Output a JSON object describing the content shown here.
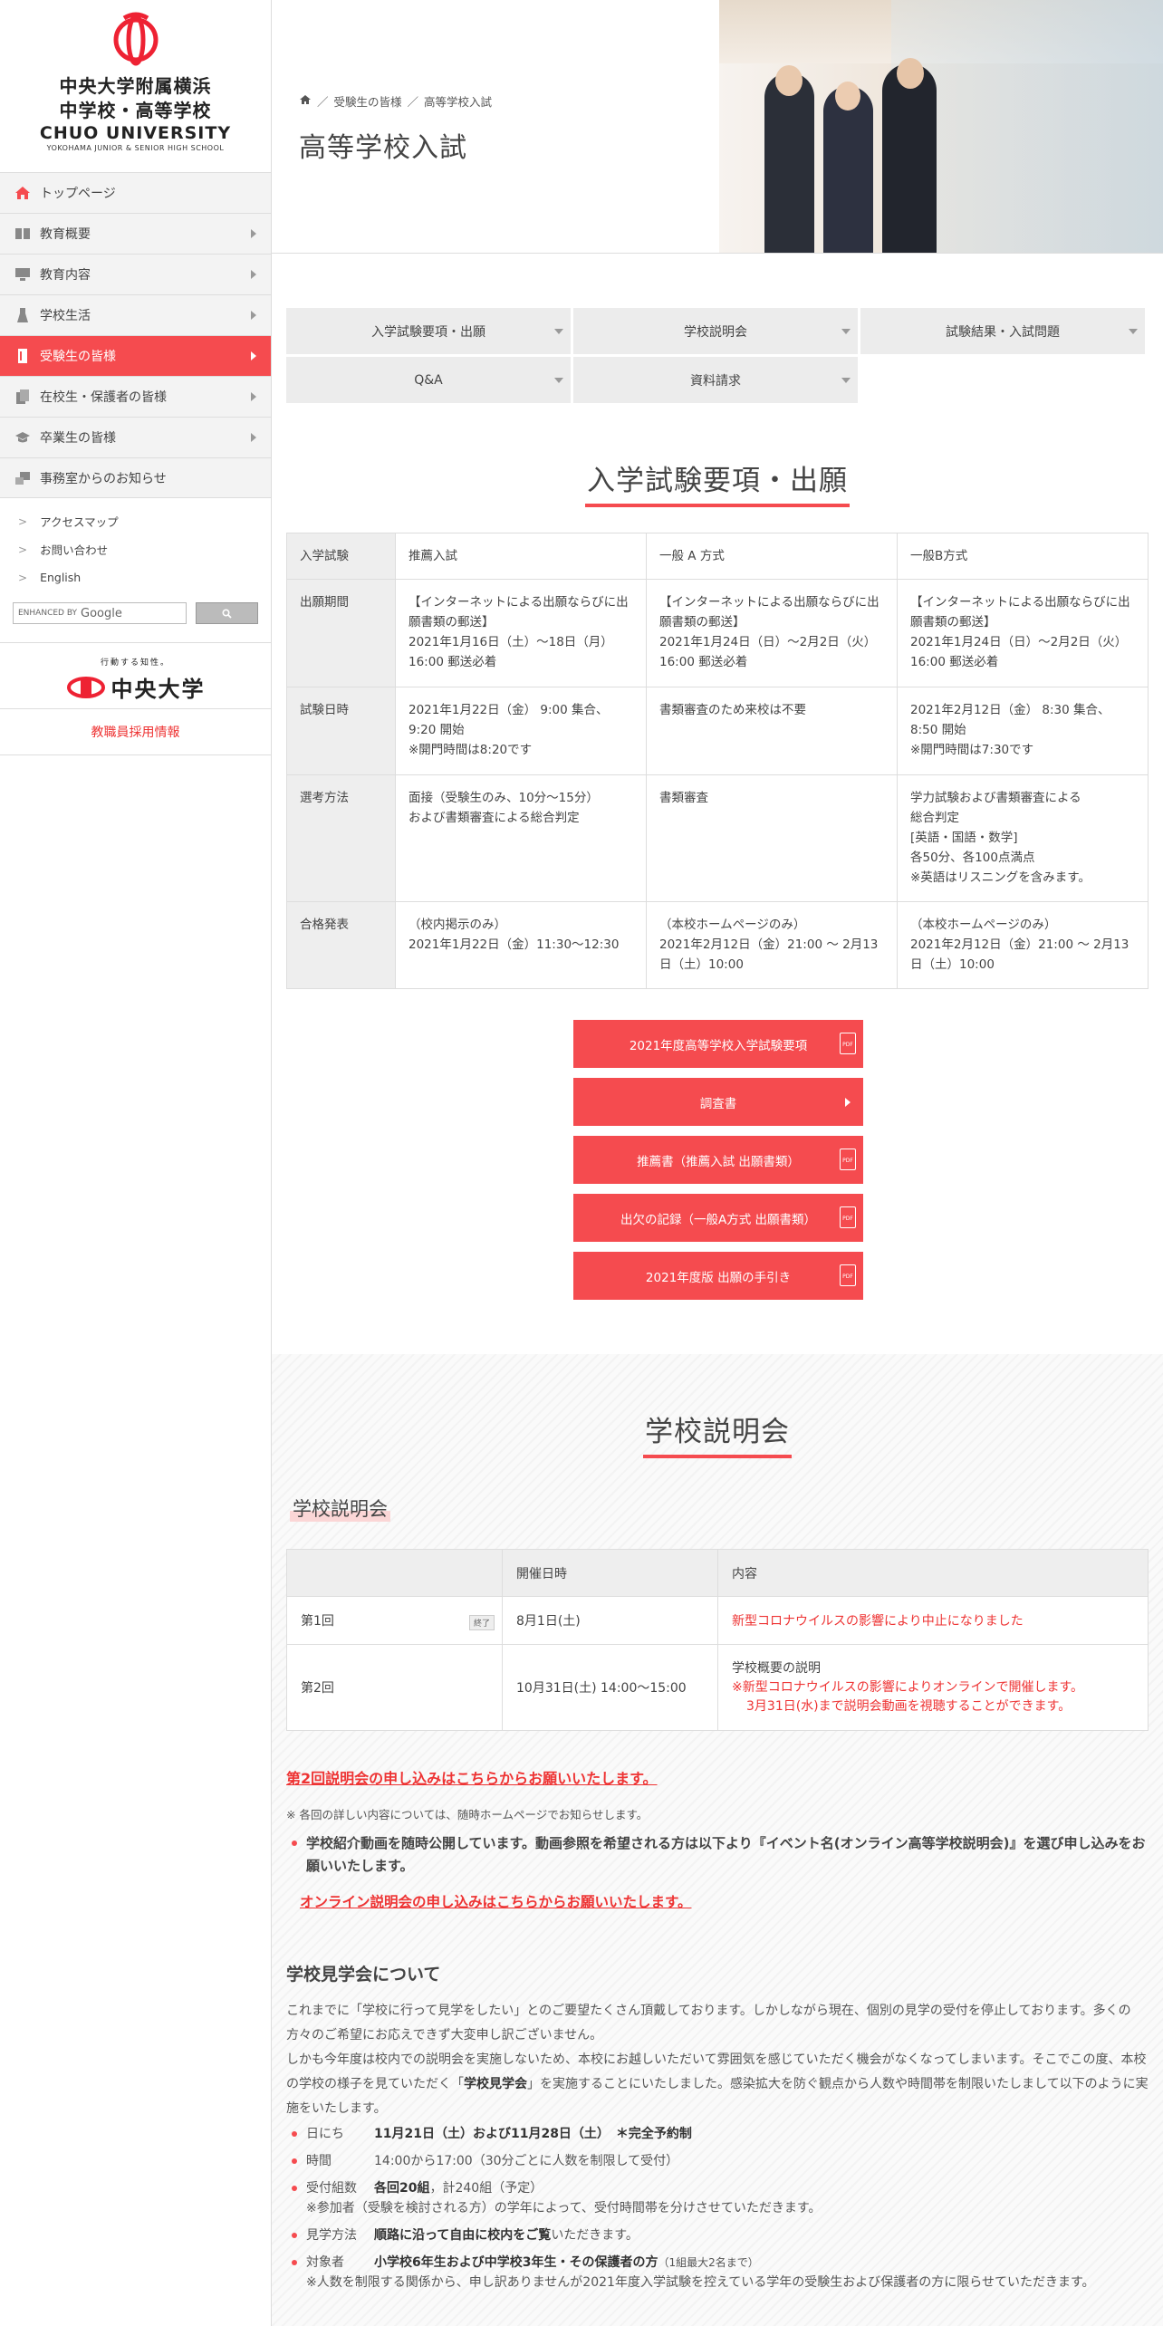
{
  "logo": {
    "line1": "中央大学附属横浜",
    "line2": "中学校・高等学校",
    "line3": "CHUO UNIVERSITY",
    "line4": "YOKOHAMA JUNIOR & SENIOR HIGH SCHOOL"
  },
  "sidebar": {
    "items": [
      {
        "label": "トップページ"
      },
      {
        "label": "教育概要"
      },
      {
        "label": "教育内容"
      },
      {
        "label": "学校生活"
      },
      {
        "label": "受験生の皆様"
      },
      {
        "label": "在校生・保護者の皆様"
      },
      {
        "label": "卒業生の皆様"
      },
      {
        "label": "事務室からのお知らせ"
      }
    ],
    "sublinks": [
      {
        "label": "アクセスマップ"
      },
      {
        "label": "お問い合わせ"
      },
      {
        "label": "English"
      }
    ],
    "search": {
      "enhanced": "ENHANCED BY",
      "google": "Google"
    },
    "chuo": {
      "slogan": "行動する知性。",
      "name": "中央大学"
    },
    "recruit": "教職員採用情報"
  },
  "header": {
    "breadcrumb": [
      "受験生の皆様",
      "高等学校入試"
    ],
    "sep": "／",
    "title": "高等学校入試"
  },
  "tabs": [
    {
      "label": "入学試験要項・出願"
    },
    {
      "label": "学校説明会"
    },
    {
      "label": "試験結果・入試問題"
    },
    {
      "label": "Q&A"
    },
    {
      "label": "資料請求"
    }
  ],
  "section1": {
    "title": "入学試験要項・出願",
    "table": {
      "header": [
        "入学試験",
        "推薦入試",
        "一般 A 方式",
        "一般B方式"
      ],
      "rows": [
        {
          "h": "出願期間",
          "c": [
            "【インターネットによる出願ならびに出願書類の郵送】\n2021年1月16日（土）～18日（月）16:00 郵送必着",
            "【インターネットによる出願ならびに出願書類の郵送】\n2021年1月24日（日）～2月2日（火）16:00 郵送必着",
            "【インターネットによる出願ならびに出願書類の郵送】\n2021年1月24日（日）～2月2日（火）16:00 郵送必着"
          ]
        },
        {
          "h": "試験日時",
          "c": [
            "2021年1月22日（金） 9:00 集合、9:20 開始\n※開門時間は8:20です",
            "書類審査のため来校は不要",
            "2021年2月12日（金） 8:30 集合、8:50 開始\n※開門時間は7:30です"
          ]
        },
        {
          "h": "選考方法",
          "c": [
            "面接（受験生のみ、10分～15分）\nおよび書類審査による総合判定",
            "書類審査",
            "学力試験および書類審査による\n総合判定\n[英語・国語・数学]\n各50分、各100点満点\n※英語はリスニングを含みます。"
          ]
        },
        {
          "h": "合格発表",
          "c": [
            "（校内掲示のみ）\n2021年1月22日（金）11:30～12:30",
            "（本校ホームページのみ）\n2021年2月12日（金）21:00 ～ 2月13日（土）10:00",
            "（本校ホームページのみ）\n2021年2月12日（金）21:00 ～ 2月13日（土）10:00"
          ]
        }
      ]
    },
    "buttons": [
      {
        "label": "2021年度高等学校入学試験要項",
        "icon": "pdf"
      },
      {
        "label": "調査書",
        "icon": "arrow"
      },
      {
        "label": "推薦書（推薦入試 出願書類）",
        "icon": "pdf"
      },
      {
        "label": "出欠の記録（一般A方式 出願書類）",
        "icon": "pdf"
      },
      {
        "label": "2021年度版 出願の手引き",
        "icon": "pdf"
      }
    ],
    "pdf_text": "PDF"
  },
  "section2": {
    "title": "学校説明会",
    "subtitle": "学校説明会",
    "table": {
      "header": [
        "",
        "開催日時",
        "内容"
      ],
      "rows": [
        {
          "name": "第1回",
          "badge": "終了",
          "date": "8月1日(土)",
          "content": "新型コロナウイルスの影響により中止になりました"
        },
        {
          "name": "第2回",
          "badge": "",
          "date": "10月31日(土) 14:00～15:00",
          "content1": "学校概要の説明",
          "content2": "※新型コロナウイルスの影響によりオンラインで開催します。",
          "content3": "3月31日(水)まで説明会動画を視聴することができます。"
        }
      ]
    },
    "link1": "第2回説明会の申し込みはこちらからお願いいたします。",
    "note": "※ 各回の詳しい内容については、随時ホームページでお知らせします。",
    "bullet1": "学校紹介動画を随時公開しています。動画参照を希望される方は以下より『イベント名(オンライン高等学校説明会)』を選び申し込みをお願いいたします。",
    "link2": "オンライン説明会の申し込みはこちらからお願いいたします。",
    "visit_title": "学校見学会について",
    "para1": "これまでに「学校に行って見学をしたい」とのご要望たくさん頂戴しております。しかしながら現在、個別の見学の受付を停止しております。多くの方々のご希望にお応えできず大変申し訳ございません。",
    "para2a": "しかも今年度は校内での説明会を実施しないため、本校にお越しいただいて雰囲気を感じていただく機会がなくなってしまいます。そこでこの度、本校の学校の様子を見ていただく「",
    "para2b": "学校見学会",
    "para2c": "」を実施することにいたしました。感染拡大を防ぐ観点から人数や時間帯を制限いたしまして以下のように実施をいたします。",
    "items": [
      {
        "label": "日にち",
        "bold": "11月21日（土）および11月28日（土）　＊完全予約制",
        "rest": ""
      },
      {
        "label": "時間",
        "bold": "",
        "rest": "14:00から17:00（30分ごとに人数を制限して受付）"
      },
      {
        "label": "受付組数",
        "bold": "各回20組",
        "rest": "，計240組（予定）",
        "line2": "※参加者（受験を検討される方）の学年によって、受付時間帯を分けさせていただきます。"
      },
      {
        "label": "見学方法",
        "bold": "順路に沿って自由に校内をご覧",
        "rest": "いただきます。"
      },
      {
        "label": "対象者",
        "bold": "小学校6年生および中学校3年生・その保護者の方",
        "rest": "（1組最大2名まで）",
        "line2": "※人数を制限する関係から、申し訳ありませんが2021年度入学試験を控えている学年の受験生および保護者の方に限らせていただきます。"
      }
    ]
  },
  "colors": {
    "accent": "#f54b4f",
    "link": "#e33333"
  }
}
